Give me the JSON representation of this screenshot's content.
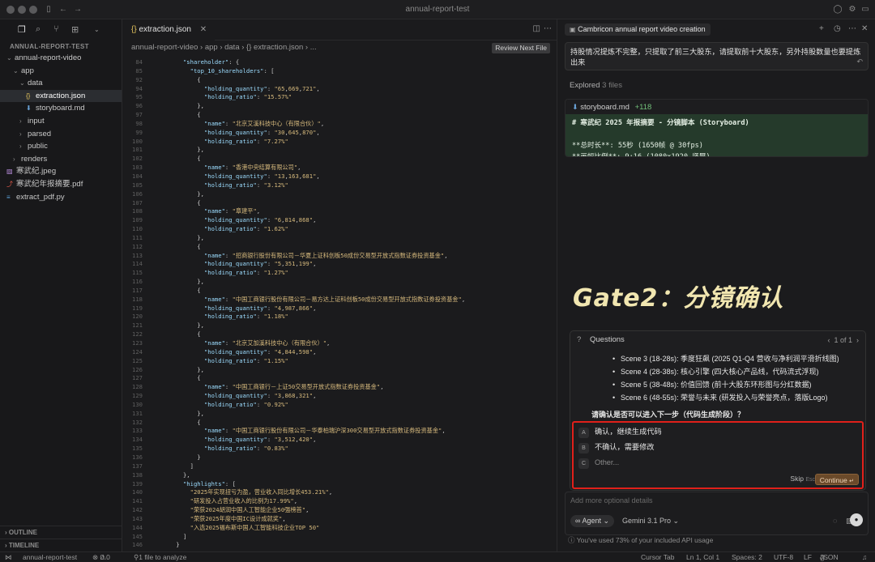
{
  "window": {
    "title": "annual-report-test"
  },
  "sidebar": {
    "project": "ANNUAL-REPORT-TEST",
    "tree": [
      {
        "label": "annual-report-video",
        "depth": 1,
        "kind": "folder-open",
        "icon": "chevron-down-icon"
      },
      {
        "label": "app",
        "depth": 2,
        "kind": "folder-open",
        "icon": "chevron-down-icon"
      },
      {
        "label": "data",
        "depth": 3,
        "kind": "folder-open",
        "icon": "chevron-down-icon"
      },
      {
        "label": "extraction.json",
        "depth": 4,
        "kind": "json",
        "icon": "json-file-icon",
        "active": true
      },
      {
        "label": "storyboard.md",
        "depth": 4,
        "kind": "md",
        "icon": "markdown-file-icon"
      },
      {
        "label": "input",
        "depth": 3,
        "kind": "folder",
        "icon": "chevron-right-icon"
      },
      {
        "label": "parsed",
        "depth": 3,
        "kind": "folder",
        "icon": "chevron-right-icon"
      },
      {
        "label": "public",
        "depth": 3,
        "kind": "folder",
        "icon": "chevron-right-icon"
      },
      {
        "label": "renders",
        "depth": 2,
        "kind": "folder",
        "icon": "chevron-right-icon"
      },
      {
        "label": "寒武纪.jpeg",
        "depth": 1,
        "kind": "image",
        "icon": "image-file-icon"
      },
      {
        "label": "寒武纪年报摘要.pdf",
        "depth": 1,
        "kind": "pdf",
        "icon": "pdf-file-icon"
      },
      {
        "label": "extract_pdf.py",
        "depth": 1,
        "kind": "py",
        "icon": "python-file-icon"
      }
    ],
    "outline": "OUTLINE",
    "timeline": "TIMELINE"
  },
  "editor": {
    "tab_label": "extraction.json",
    "breadcrumb": "annual-report-video  ›  app  ›  data  ›  {}  extraction.json  ›  ...",
    "review_label": "Review Next File",
    "lines": [
      {
        "n": "84",
        "t": "      \"shareholder\": {"
      },
      {
        "n": "85",
        "t": "        \"top_10_shareholders\": ["
      },
      {
        "n": "92",
        "t": "          {"
      },
      {
        "n": "94",
        "t": "            \"holding_quantity\": \"65,669,721\","
      },
      {
        "n": "95",
        "t": "            \"holding_ratio\": \"15.57%\""
      },
      {
        "n": "96",
        "t": "          },"
      },
      {
        "n": "97",
        "t": "          {"
      },
      {
        "n": "98",
        "t": "            \"name\": \"北京艾溪科技中心（有限合伙）\","
      },
      {
        "n": "99",
        "t": "            \"holding_quantity\": \"30,645,870\","
      },
      {
        "n": "100",
        "t": "            \"holding_ratio\": \"7.27%\""
      },
      {
        "n": "101",
        "t": "          },"
      },
      {
        "n": "102",
        "t": "          {"
      },
      {
        "n": "103",
        "t": "            \"name\": \"香港中央结算有限公司\","
      },
      {
        "n": "104",
        "t": "            \"holding_quantity\": \"13,163,681\","
      },
      {
        "n": "105",
        "t": "            \"holding_ratio\": \"3.12%\""
      },
      {
        "n": "106",
        "t": "          },"
      },
      {
        "n": "107",
        "t": "          {"
      },
      {
        "n": "108",
        "t": "            \"name\": \"章建平\","
      },
      {
        "n": "109",
        "t": "            \"holding_quantity\": \"6,814,868\","
      },
      {
        "n": "110",
        "t": "            \"holding_ratio\": \"1.62%\""
      },
      {
        "n": "111",
        "t": "          },"
      },
      {
        "n": "112",
        "t": "          {"
      },
      {
        "n": "113",
        "t": "            \"name\": \"招商银行股份有限公司－华夏上证科创板50成份交易型开放式指数证券投资基金\","
      },
      {
        "n": "114",
        "t": "            \"holding_quantity\": \"5,351,199\","
      },
      {
        "n": "115",
        "t": "            \"holding_ratio\": \"1.27%\""
      },
      {
        "n": "116",
        "t": "          },"
      },
      {
        "n": "117",
        "t": "          {"
      },
      {
        "n": "118",
        "t": "            \"name\": \"中国工商银行股份有限公司－易方达上证科创板50成份交易型开放式指数证券投资基金\","
      },
      {
        "n": "119",
        "t": "            \"holding_quantity\": \"4,987,866\","
      },
      {
        "n": "120",
        "t": "            \"holding_ratio\": \"1.18%\""
      },
      {
        "n": "121",
        "t": "          },"
      },
      {
        "n": "122",
        "t": "          {"
      },
      {
        "n": "123",
        "t": "            \"name\": \"北京艾加溪科技中心（有限合伙）\","
      },
      {
        "n": "124",
        "t": "            \"holding_quantity\": \"4,844,598\","
      },
      {
        "n": "125",
        "t": "            \"holding_ratio\": \"1.15%\""
      },
      {
        "n": "126",
        "t": "          },"
      },
      {
        "n": "127",
        "t": "          {"
      },
      {
        "n": "128",
        "t": "            \"name\": \"中国工商银行－上证50交易型开放式指数证券投资基金\","
      },
      {
        "n": "129",
        "t": "            \"holding_quantity\": \"3,868,321\","
      },
      {
        "n": "130",
        "t": "            \"holding_ratio\": \"0.92%\""
      },
      {
        "n": "131",
        "t": "          },"
      },
      {
        "n": "132",
        "t": "          {"
      },
      {
        "n": "133",
        "t": "            \"name\": \"中国工商银行股份有限公司－华泰柏瑞沪深300交易型开放式指数证券投资基金\","
      },
      {
        "n": "134",
        "t": "            \"holding_quantity\": \"3,512,420\","
      },
      {
        "n": "135",
        "t": "            \"holding_ratio\": \"0.83%\""
      },
      {
        "n": "136",
        "t": "          }"
      },
      {
        "n": "137",
        "t": "        ]"
      },
      {
        "n": "138",
        "t": "      },"
      },
      {
        "n": "139",
        "t": "      \"highlights\": ["
      },
      {
        "n": "140",
        "t": "        \"2025年实现扭亏为盈，营业收入同比增长453.21%\","
      },
      {
        "n": "141",
        "t": "        \"研发投入占营业收入的比例为17.99%\","
      },
      {
        "n": "142",
        "t": "        \"荣获2024胡润中国人工智能企业50强榜首\","
      },
      {
        "n": "143",
        "t": "        \"荣获2025年度中国IC设计成就奖\","
      },
      {
        "n": "144",
        "t": "        \"入选2025福布斯中国人工智能科技企业TOP 50\""
      },
      {
        "n": "145",
        "t": "      ]"
      },
      {
        "n": "146",
        "t": "    }"
      }
    ]
  },
  "chat": {
    "tab_label": "Cambricon annual report video creation",
    "user_message": "持股情况提炼不完整，只提取了前三大股东，请提取前十大股东，另外持股数量也要提炼出来",
    "explored_prefix": "Explored",
    "explored_count": "3 files",
    "file_card": {
      "name": "storyboard.md",
      "added": "+118",
      "lines": [
        "# 寒武纪 2025 年报摘要 - 分镜脚本 (Storyboard)",
        "",
        "**总时长**: 55秒 (1650帧 @ 30fps)",
        "**画幅比例**: 9:16 (1080x1920 竖屏)"
      ]
    },
    "overlay_text": "Gate2：分镜确认",
    "questions": {
      "title": "Questions",
      "pager": "1 of 1",
      "bullets": [
        "Scene 3 (18-28s): 季度狂飙 (2025 Q1-Q4 营收与净利润平滑折线图)",
        "Scene 4 (28-38s): 核心引擎 (四大核心产品线，代码流式浮现)",
        "Scene 5 (38-48s): 价值回馈 (前十大股东环形图与分红数据)",
        "Scene 6 (48-55s): 荣誉与未来 (研发投入与荣誉亮点，落版Logo)"
      ],
      "question": "请确认是否可以进入下一步（代码生成阶段）？",
      "choices": [
        {
          "letter": "A",
          "label": "确认，继续生成代码"
        },
        {
          "letter": "B",
          "label": "不确认，需要修改"
        },
        {
          "letter": "C",
          "label": "Other..."
        }
      ],
      "skip_label": "Skip",
      "skip_key": "Esc",
      "continue_label": "Continue"
    },
    "input_placeholder": "Add more optional details",
    "agent_label": "Agent",
    "model_label": "Gemini 3.1 Pro",
    "usage": "You've used 73% of your included API usage"
  },
  "statusbar": {
    "workspace": "annual-report-test",
    "errors": "0",
    "warnings": "0",
    "analyze": "1 file to analyze",
    "cursor_tab": "Cursor Tab",
    "position": "Ln 1, Col 1",
    "spaces": "Spaces: 2",
    "encoding": "UTF-8",
    "eol": "LF",
    "language": "JSON"
  },
  "colors": {
    "accent_red": "#e0201a",
    "continue_bg": "#6b4a2a",
    "added_green": "#72c07a"
  }
}
